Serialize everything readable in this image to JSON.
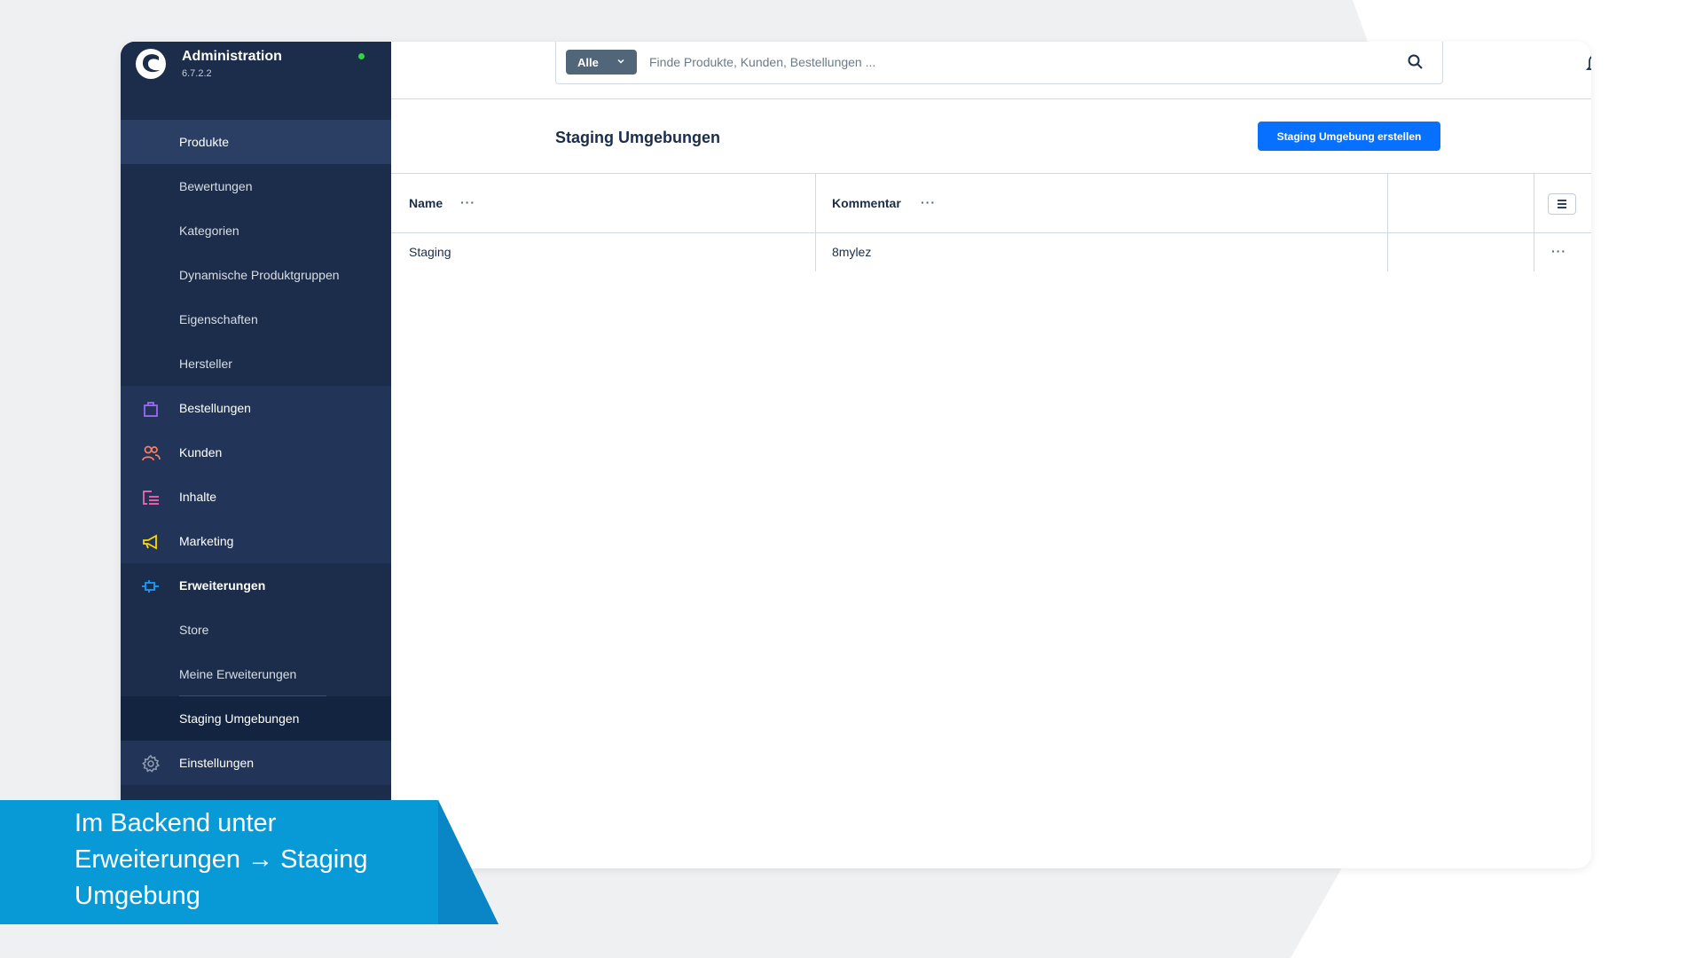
{
  "app": {
    "title": "Administration",
    "version": "6.7.2.2",
    "status_color": "#37d046"
  },
  "sidebar": {
    "items": [
      {
        "label": "Produkte",
        "kind": "sub",
        "state": "active-top"
      },
      {
        "label": "Bewertungen",
        "kind": "sub"
      },
      {
        "label": "Kategorien",
        "kind": "sub"
      },
      {
        "label": "Dynamische Produktgruppen",
        "kind": "sub"
      },
      {
        "label": "Eigenschaften",
        "kind": "sub"
      },
      {
        "label": "Hersteller",
        "kind": "sub"
      },
      {
        "label": "Bestellungen",
        "kind": "main",
        "icon": "shopping-bag-icon",
        "icon_color": "#9f6bff"
      },
      {
        "label": "Kunden",
        "kind": "main",
        "icon": "users-icon",
        "icon_color": "#ff7b5f"
      },
      {
        "label": "Inhalte",
        "kind": "main",
        "icon": "content-icon",
        "icon_color": "#ff68b4"
      },
      {
        "label": "Marketing",
        "kind": "main",
        "icon": "megaphone-icon",
        "icon_color": "#ffd700"
      },
      {
        "label": "Erweiterungen",
        "kind": "main",
        "icon": "plug-icon",
        "icon_color": "#189eff",
        "state": "open"
      },
      {
        "label": "Store",
        "kind": "sub"
      },
      {
        "label": "Meine Erweiterungen",
        "kind": "sub"
      },
      {
        "label": "Staging Umgebungen",
        "kind": "sub",
        "state": "selected"
      },
      {
        "label": "Einstellungen",
        "kind": "main",
        "icon": "gear-icon",
        "icon_color": "#8e9cb0"
      }
    ]
  },
  "topbar": {
    "search_type": "Alle",
    "search_placeholder": "Finde Produkte, Kunden, Bestellungen ...",
    "notification_badge_color": "#de294c"
  },
  "page": {
    "title": "Staging Umgebungen",
    "create_button": "Staging Umgebung erstellen"
  },
  "table": {
    "columns": [
      "Name",
      "Kommentar"
    ],
    "column_menu": "···",
    "rows": [
      {
        "name": "Staging",
        "comment": "8mylez",
        "actions": "···"
      }
    ]
  },
  "caption": {
    "text": "Im Backend unter Erweiterungen → Staging Umgebung"
  },
  "colors": {
    "sidebar_bg": "#1b2d4b",
    "primary": "#0870ff",
    "caption_bg": "#089ad6"
  }
}
